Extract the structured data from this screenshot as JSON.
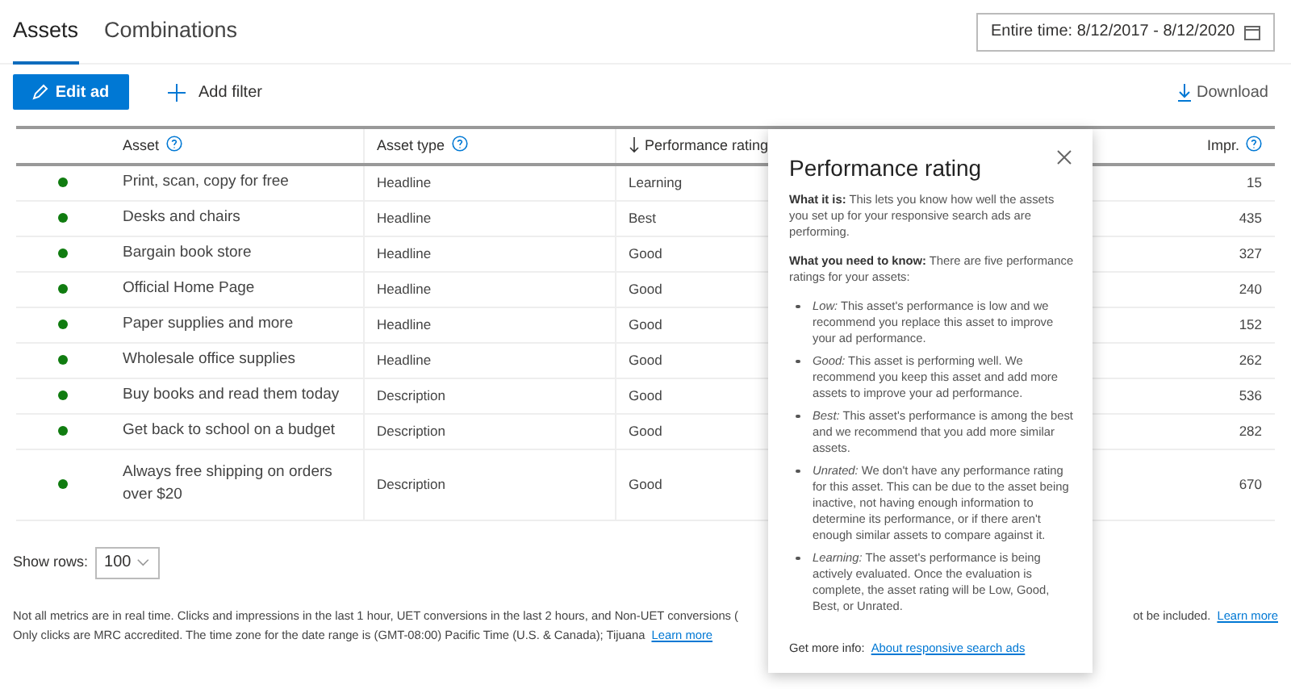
{
  "tabs": [
    {
      "label": "Assets",
      "selected": true
    },
    {
      "label": "Combinations",
      "selected": false
    }
  ],
  "date_range": {
    "value": "Entire time: 8/12/2017 - 8/12/2020"
  },
  "toolbar": {
    "edit_button": "Edit ad",
    "add_filter": "Add filter",
    "download": "Download"
  },
  "table": {
    "columns": [
      "Asset",
      "Asset type",
      "Performance rating",
      "Impr."
    ],
    "rows": [
      {
        "color": "#107c10",
        "asset": "Print, scan, copy for free",
        "type": "Headline",
        "rating": "Learning",
        "impr": "15"
      },
      {
        "color": "#107c10",
        "asset": "Desks and chairs",
        "type": "Headline",
        "rating": "Best",
        "impr": "435"
      },
      {
        "color": "#107c10",
        "asset": "Bargain book store",
        "type": "Headline",
        "rating": "Good",
        "impr": "327"
      },
      {
        "color": "#107c10",
        "asset": "Official Home Page",
        "type": "Headline",
        "rating": "Good",
        "impr": "240"
      },
      {
        "color": "#107c10",
        "asset": "Paper supplies and more",
        "type": "Headline",
        "rating": "Good",
        "impr": "152"
      },
      {
        "color": "#107c10",
        "asset": "Wholesale office supplies",
        "type": "Headline",
        "rating": "Good",
        "impr": "262"
      },
      {
        "color": "#107c10",
        "asset": "Buy books and read them today",
        "type": "Description",
        "rating": "Good",
        "impr": "536"
      },
      {
        "color": "#107c10",
        "asset": "Get back to school on a budget",
        "type": "Description",
        "rating": "Good",
        "impr": "282"
      },
      {
        "color": "#107c10",
        "asset": "Always free shipping on orders over $20",
        "type": "Description",
        "rating": "Good",
        "impr": "670"
      }
    ]
  },
  "show_rows": {
    "label": "Show rows:",
    "value": "100"
  },
  "footer": {
    "line_1_left": "Not all metrics are in real time. Clicks and impressions in the last 1 hour, UET conversions in the last 2 hours, and Non-UET conversions (",
    "line_1_right": "ot be included.",
    "line_1_link": "Learn more",
    "line_2": "Only clicks are MRC accredited. The time zone for the date range is (GMT-08:00) Pacific Time (U.S. & Canada); Tijuana",
    "line_2_link": "Learn more"
  },
  "popover": {
    "title": "Performance rating",
    "paragraphs": [
      "**What it is:** This lets you know how well the assets you set up for your responsive search ads are performing.",
      "**What you need to know:** There are five performance ratings for your assets:"
    ],
    "bullets": [
      "*Low:* This asset's performance is low and we recommend you replace this asset to improve your ad performance.",
      "*Good:* This asset is performing well. We recommend you keep this asset and add more assets to improve your ad performance.",
      "*Best:* This asset's performance is among the best and we recommend that you add more similar assets.",
      "*Unrated:* We don't have any performance rating for this asset. This can be due to the asset being inactive, not having enough information to determine its performance, or if there aren't enough similar assets to compare against it.",
      "*Learning:* The asset's performance is being actively evaluated. Once the evaluation is complete, the asset rating will be Low, Good, Best, or Unrated."
    ],
    "more_label": "Get more info:",
    "more_link": "About responsive search ads"
  }
}
